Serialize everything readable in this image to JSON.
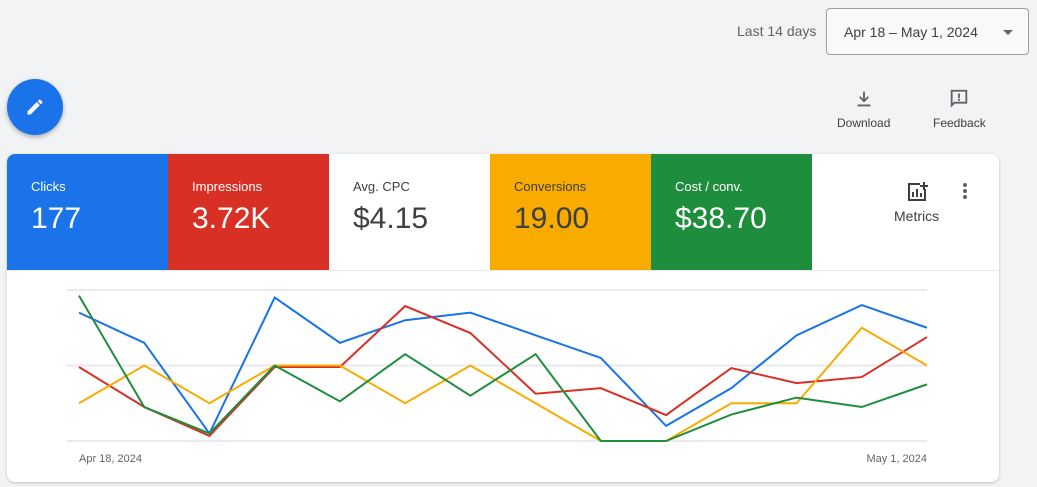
{
  "header": {
    "range_label": "Last 14 days",
    "date_range": "Apr 18 – May 1, 2024"
  },
  "fab": {
    "icon": "pencil-icon"
  },
  "toolbar": {
    "download": "Download",
    "feedback": "Feedback"
  },
  "tiles": [
    {
      "label": "Clicks",
      "value": "177",
      "bg": "#1a73e8",
      "fg": "#ffffff"
    },
    {
      "label": "Impressions",
      "value": "3.72K",
      "bg": "#d93025",
      "fg": "#ffffff"
    },
    {
      "label": "Avg. CPC",
      "value": "$4.15",
      "bg": "#ffffff",
      "fg": "#3c4043"
    },
    {
      "label": "Conversions",
      "value": "19.00",
      "bg": "#f9ab00",
      "fg": "#3c4043"
    },
    {
      "label": "Cost / conv.",
      "value": "$38.70",
      "bg": "#1e8e3e",
      "fg": "#ffffff"
    }
  ],
  "metrics_label": "Metrics",
  "chart_data": {
    "type": "line",
    "x_labels": [
      "Apr 18, 2024",
      "May 1, 2024"
    ],
    "x": [
      "Apr 18",
      "Apr 19",
      "Apr 20",
      "Apr 21",
      "Apr 22",
      "Apr 23",
      "Apr 24",
      "Apr 25",
      "Apr 26",
      "Apr 27",
      "Apr 28",
      "Apr 29",
      "Apr 30",
      "May 1"
    ],
    "series": [
      {
        "name": "Clicks",
        "color": "#1a73e8",
        "ylim": [
          0,
          20
        ],
        "values": [
          17,
          13,
          1,
          19,
          13,
          16,
          17,
          14,
          11,
          2,
          7,
          14,
          18,
          15
        ]
      },
      {
        "name": "Impressions",
        "color": "#d93025",
        "ylim": [
          0,
          600
        ],
        "values": [
          294,
          135,
          20,
          294,
          294,
          536,
          429,
          188,
          210,
          103,
          290,
          230,
          254,
          413
        ]
      },
      {
        "name": "Conversions",
        "color": "#f9ab00",
        "ylim": [
          0,
          4
        ],
        "values": [
          1,
          2,
          1,
          2,
          2,
          1,
          2,
          1,
          0,
          0,
          1,
          1,
          3,
          2
        ]
      },
      {
        "name": "Cost / conv.",
        "color": "#1e8e3e",
        "ylim": [
          0,
          80
        ],
        "values": [
          77,
          18,
          4,
          40,
          21,
          46,
          24,
          46,
          0,
          0,
          14,
          23,
          18,
          30
        ]
      }
    ],
    "grid": true
  }
}
